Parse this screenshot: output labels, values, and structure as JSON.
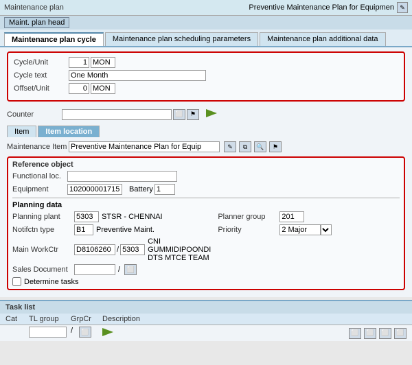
{
  "header": {
    "label": "Maintenance plan",
    "value": "Preventive Maintenance Plan for Equipmen",
    "nav_button": "Maint. plan head"
  },
  "tabs": [
    {
      "id": "cycle",
      "label": "Maintenance plan cycle",
      "active": true
    },
    {
      "id": "scheduling",
      "label": "Maintenance plan scheduling parameters",
      "active": false
    },
    {
      "id": "additional",
      "label": "Maintenance plan additional data",
      "active": false
    }
  ],
  "cycle_section": {
    "cycle_unit_label": "Cycle/Unit",
    "cycle_unit_value": "1",
    "cycle_unit_unit": "MON",
    "cycle_text_label": "Cycle text",
    "cycle_text_value": "One Month",
    "offset_unit_label": "Offset/Unit",
    "offset_unit_value": "0",
    "offset_unit_unit": "MON",
    "counter_label": "Counter"
  },
  "item_tabs": [
    {
      "id": "item",
      "label": "Item",
      "active": false
    },
    {
      "id": "item_location",
      "label": "Item location",
      "active": true
    }
  ],
  "maintenance_item": {
    "label": "Maintenance Item",
    "value": "Preventive Maintenance Plan for Equip"
  },
  "reference_object": {
    "title": "Reference object",
    "functional_loc_label": "Functional loc.",
    "functional_loc_value": "",
    "equipment_label": "Equipment",
    "equipment_value": "102000001715",
    "battery_label": "Battery",
    "battery_value": "1"
  },
  "planning_data": {
    "title": "Planning data",
    "planning_plant_label": "Planning plant",
    "planning_plant_value": "5303",
    "planning_plant_name": "STSR - CHENNAI",
    "planner_group_label": "Planner group",
    "planner_group_value": "201",
    "notifctn_type_label": "Notifctn type",
    "notifctn_type_value": "B1",
    "notifctn_type_name": "Preventive Maint.",
    "priority_label": "Priority",
    "priority_value": "2 Major",
    "main_workctr_label": "Main WorkCtr",
    "main_workctr_value1": "D8106260",
    "main_workctr_value2": "5303",
    "main_workctr_name": "CNI GUMMIDIPOONDI DTS MTCE TEAM",
    "sales_document_label": "Sales Document",
    "sales_document_value": "",
    "sales_document_sub": "/",
    "determine_tasks_label": "Determine tasks"
  },
  "task_list": {
    "title": "Task list",
    "col_cat": "Cat",
    "col_tl_group": "TL group",
    "col_grpcr": "GrpCr",
    "col_description": "Description"
  },
  "icons": {
    "edit": "✎",
    "search": "🔍",
    "save": "💾",
    "flag": "⚑",
    "arrow_green": "▶",
    "dropdown": "▼"
  }
}
